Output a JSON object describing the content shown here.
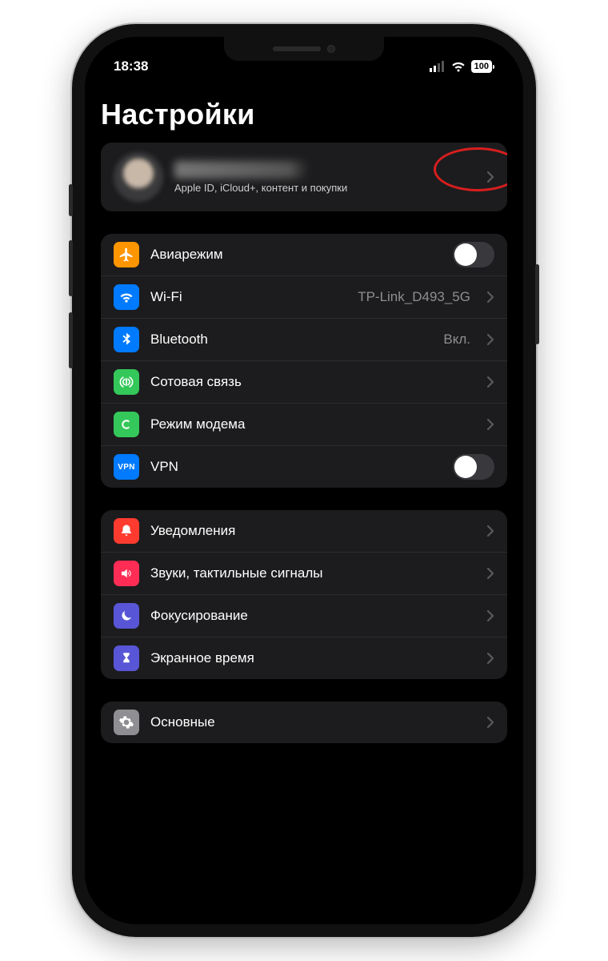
{
  "status": {
    "time": "18:38",
    "battery": "100"
  },
  "title": "Настройки",
  "profile": {
    "subtitle": "Apple ID, iCloud+, контент и покупки"
  },
  "group1": {
    "airplane": {
      "label": "Авиарежим",
      "color": "#ff9500"
    },
    "wifi": {
      "label": "Wi-Fi",
      "value": "TP-Link_D493_5G",
      "color": "#007aff"
    },
    "bluetooth": {
      "label": "Bluetooth",
      "value": "Вкл.",
      "color": "#007aff"
    },
    "cellular": {
      "label": "Сотовая связь",
      "color": "#34c759"
    },
    "hotspot": {
      "label": "Режим модема",
      "color": "#34c759"
    },
    "vpn": {
      "label": "VPN",
      "color": "#007aff",
      "badge": "VPN"
    }
  },
  "group2": {
    "notifications": {
      "label": "Уведомления",
      "color": "#ff3b30"
    },
    "sounds": {
      "label": "Звуки, тактильные сигналы",
      "color": "#ff2d55"
    },
    "focus": {
      "label": "Фокусирование",
      "color": "#5856d6"
    },
    "screentime": {
      "label": "Экранное время",
      "color": "#5856d6"
    }
  },
  "group3": {
    "general": {
      "label": "Основные",
      "color": "#8e8e93"
    }
  }
}
